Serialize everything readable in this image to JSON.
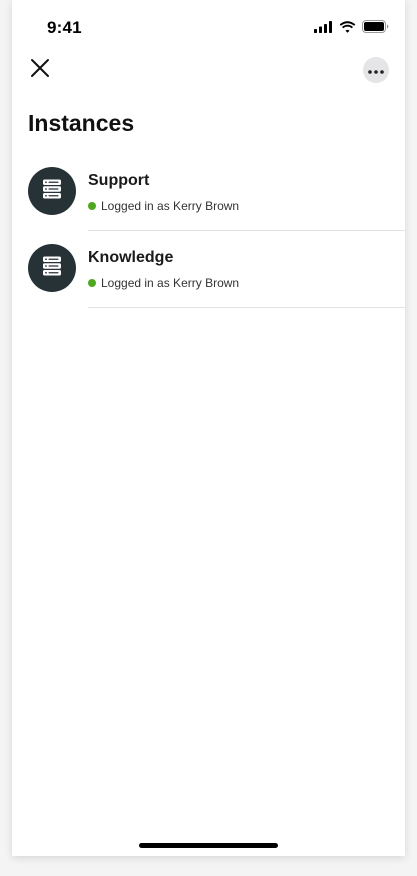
{
  "status_bar": {
    "time": "9:41",
    "icons": [
      "signal-icon",
      "wifi-icon",
      "battery-icon"
    ]
  },
  "nav": {
    "close_icon": "close-icon",
    "more_icon": "more-icon"
  },
  "page": {
    "title": "Instances"
  },
  "instances": [
    {
      "name": "Support",
      "status": "Logged in as Kerry Brown",
      "icon": "server-icon"
    },
    {
      "name": "Knowledge",
      "status": "Logged in as Kerry Brown",
      "icon": "server-icon"
    }
  ],
  "colors": {
    "avatar_bg": "#273236",
    "status_online": "#4ea721",
    "more_button_bg": "#e5e5e7"
  }
}
